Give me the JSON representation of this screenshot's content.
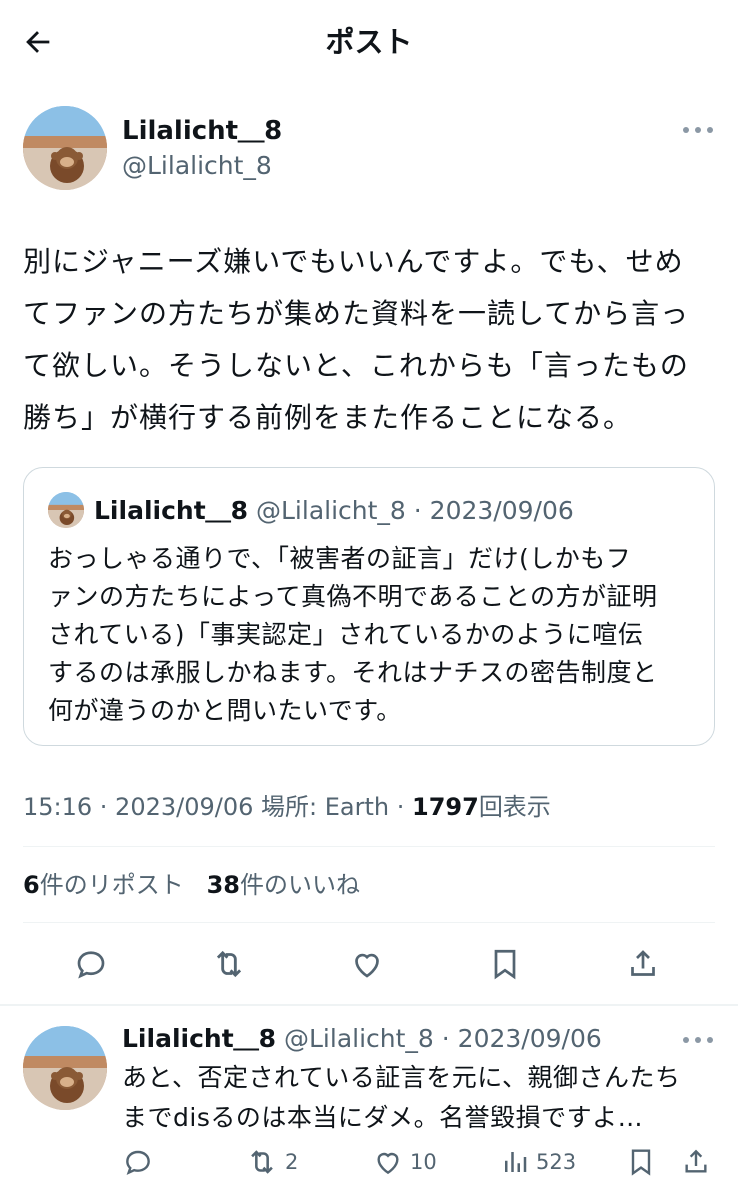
{
  "header": {
    "title": "ポスト"
  },
  "author": {
    "name": "Lilalicht＿8",
    "handle": "@Lilalicht_8"
  },
  "tweet": {
    "lines": [
      "別にジャニーズ嫌いでもいいんですよ。でも、せめ",
      "てファンの方たちが集めた資料を一読してから言っ",
      "て欲しい。そうしないと、これからも「言ったもの",
      "勝ち」が横行する前例をまた作ることになる。"
    ]
  },
  "quote": {
    "name": "Lilalicht＿8",
    "meta": "@Lilalicht_8 · 2023/09/06",
    "lines": [
      "おっしゃる通りで、「被害者の証言」だけ(しかもフ",
      "ァンの方たちによって真偽不明であることの方が証明",
      "されている)「事実認定」されているかのように喧伝",
      "するのは承服しかねます。それはナチスの密告制度と",
      "何が違うのかと問いたいです。"
    ]
  },
  "meta": {
    "time_date": "15:16 · 2023/09/06",
    "location": "場所: Earth ·",
    "views_count": "1797",
    "views_label": "回表示"
  },
  "stats": {
    "reposts_count": "6",
    "reposts_label": "件のリポスト",
    "likes_count": "38",
    "likes_label": "件のいいね"
  },
  "reply": {
    "name": "Lilalicht＿8",
    "meta": "@Lilalicht_8 · 2023/09/06",
    "lines": [
      "あと、否定されている証言を元に、親御さんたち",
      "までdisるのは本当にダメ。名誉毀損ですよ…"
    ],
    "retweets": "2",
    "likes": "10",
    "views": "523"
  },
  "icons": {
    "back": "arrow-left-icon",
    "more": "more-horizontal-icon",
    "reply": "reply-bubble-icon",
    "repost": "repost-icon",
    "like": "heart-icon",
    "bookmark": "bookmark-icon",
    "share": "share-icon",
    "views": "views-bar-icon"
  },
  "colors": {
    "text": "#0f1419",
    "secondary": "#536471",
    "border": "#cfd9de"
  }
}
